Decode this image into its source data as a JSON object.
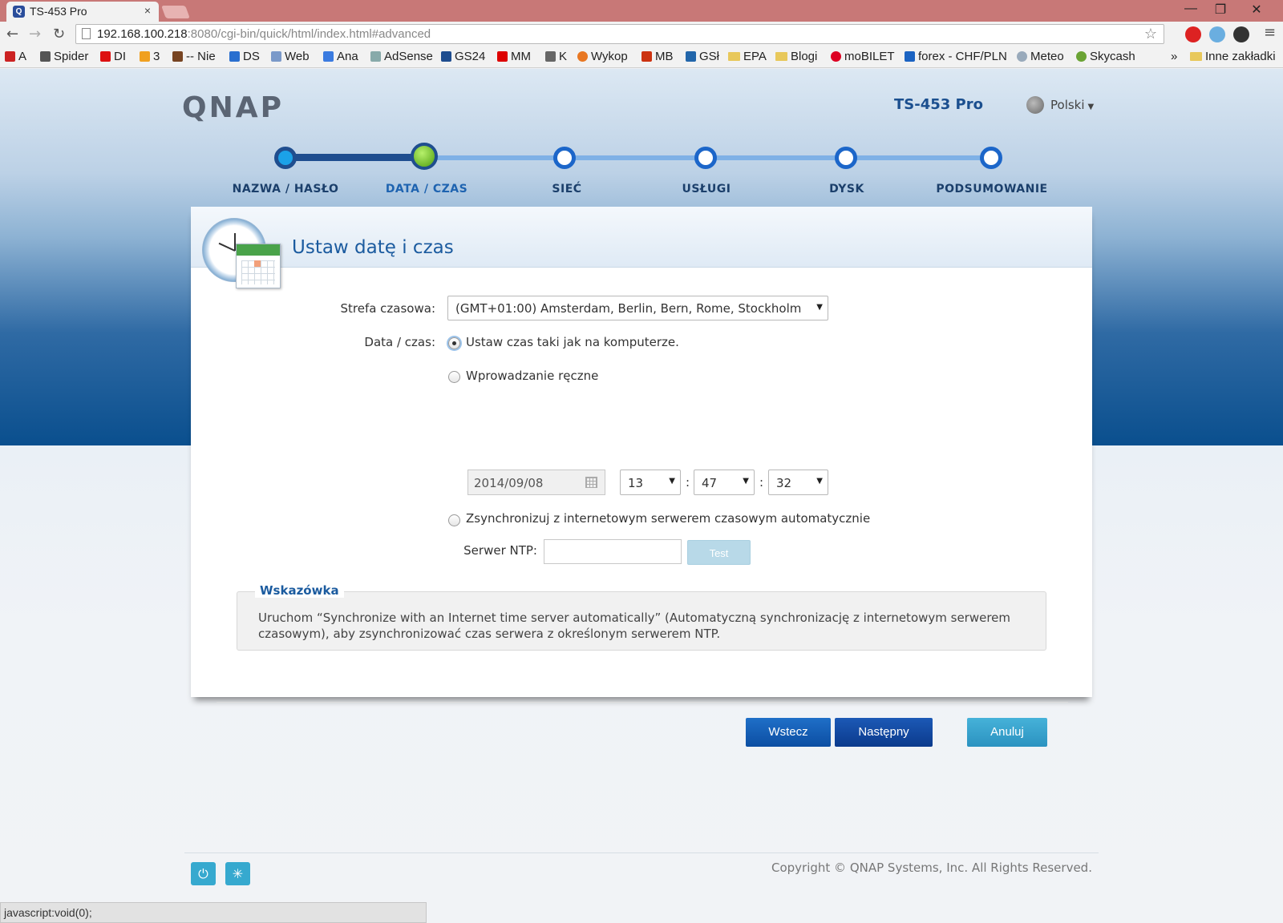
{
  "browser": {
    "tab_title": "TS-453 Pro",
    "tab_close": "×",
    "window_minimize": "—",
    "window_maximize": "❐",
    "window_close": "✕",
    "url_host": "192.168.100.218",
    "url_rest": ":8080/cgi-bin/quick/html/index.html#advanced",
    "bookmarks": [
      "A",
      "Spider",
      "DI",
      "3",
      "-- Nie",
      "DS",
      "Web",
      "Ana",
      "AdSense",
      "GS24",
      "MM",
      "K",
      "Wykop",
      "MB",
      "GSł",
      "EPA",
      "Blogi",
      "moBILET",
      "forex - CHF/PLN",
      "Meteo",
      "Skycash"
    ],
    "bookmarks_overflow": "»",
    "other_bookmarks": "Inne zakładki",
    "status_text": "javascript:void(0);"
  },
  "header": {
    "logo": "QNAP",
    "model": "TS-453 Pro",
    "language": "Polski"
  },
  "steps": [
    "NAZWA / HASŁO",
    "DATA / CZAS",
    "SIEĆ",
    "USŁUGI",
    "DYSK",
    "PODSUMOWANIE"
  ],
  "current_step": 2,
  "form": {
    "title": "Ustaw datę i czas",
    "timezone_label": "Strefa czasowa:",
    "timezone_value": "(GMT+01:00) Amsterdam, Berlin, Bern, Rome, Stockholm",
    "datetime_label": "Data / czas:",
    "option_computer": "Ustaw czas taki jak na komputerze.",
    "option_manual": "Wprowadzanie ręczne",
    "option_ntp": "Zsynchronizuj z internetowym serwerem czasowym automatycznie",
    "selected_option": "computer",
    "date_value": "2014/09/08",
    "hour": "13",
    "minute": "47",
    "second": "32",
    "time_separator": ":",
    "ntp_label": "Serwer NTP:",
    "ntp_value": "",
    "test_button": "Test"
  },
  "hint": {
    "title": "Wskazówka",
    "text": "Uruchom “Synchronize with an Internet time server automatically” (Automatyczną synchronizację z internetowym serwerem czasowym), aby zsynchronizować czas serwera z określonym serwerem NTP."
  },
  "buttons": {
    "back": "Wstecz",
    "next": "Następny",
    "cancel": "Anuluj"
  },
  "footer": {
    "copyright": "Copyright © QNAP Systems, Inc. All Rights Reserved."
  }
}
